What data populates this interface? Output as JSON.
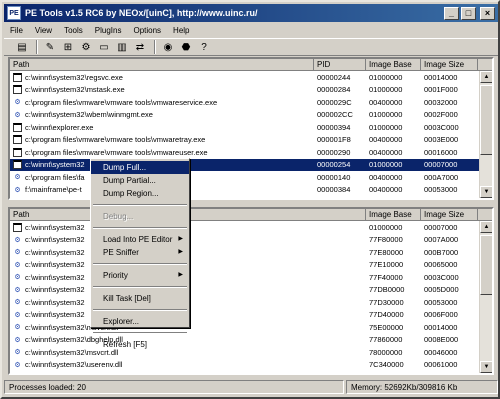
{
  "window": {
    "title": "PE Tools v1.5 RC6 by NEOx/[uinC], http://www.uinc.ru/",
    "btn_min": "_",
    "btn_max": "□",
    "btn_close": "×"
  },
  "menu": [
    "File",
    "View",
    "Tools",
    "PlugIns",
    "Options",
    "Help"
  ],
  "toolbar": {
    "icons": [
      "list-icon",
      "edit-icon",
      "tree-icon",
      "sniff-icon",
      "folder-icon",
      "editor-icon",
      "compare-icon",
      "globe-icon",
      "shield-icon",
      "help-icon"
    ],
    "glyphs": [
      "▤",
      "✎",
      "⊞",
      "⚙",
      "▭",
      "▥",
      "⇄",
      "◉",
      "⬣",
      "?"
    ]
  },
  "processes": {
    "headers": [
      "Path",
      "PID",
      "Image Base",
      "Image Size"
    ],
    "rows": [
      {
        "path": "c:\\winnt\\system32\\regsvc.exe",
        "pid": "00000244",
        "base": "01000000",
        "size": "00014000",
        "icon": "exe"
      },
      {
        "path": "c:\\winnt\\system32\\mstask.exe",
        "pid": "00000284",
        "base": "01000000",
        "size": "0001F000",
        "icon": "exe"
      },
      {
        "path": "c:\\program files\\vmware\\vmware tools\\vmwareservice.exe",
        "pid": "0000029C",
        "base": "00400000",
        "size": "00032000",
        "icon": "gear"
      },
      {
        "path": "c:\\winnt\\system32\\wbem\\winmgmt.exe",
        "pid": "000002CC",
        "base": "01000000",
        "size": "0002F000",
        "icon": "gear"
      },
      {
        "path": "c:\\winnt\\explorer.exe",
        "pid": "00000394",
        "base": "01000000",
        "size": "0003C000",
        "icon": "exe"
      },
      {
        "path": "c:\\program files\\vmware\\vmware tools\\vmwaretray.exe",
        "pid": "000001F8",
        "base": "00400000",
        "size": "0003E000",
        "icon": "exe"
      },
      {
        "path": "c:\\program files\\vmware\\vmware tools\\vmwareuser.exe",
        "pid": "00000290",
        "base": "00400000",
        "size": "00016000",
        "icon": "exe"
      },
      {
        "path": "c:\\winnt\\system32",
        "pid": "00000254",
        "base": "01000000",
        "size": "00007000",
        "icon": "exe",
        "selected": true
      },
      {
        "path": "c:\\program files\\fa",
        "pid": "00000140",
        "base": "00400000",
        "size": "000A7000",
        "icon": "gear"
      },
      {
        "path": "f:\\mainframe\\pe-t",
        "pid": "00000384",
        "base": "00400000",
        "size": "00053000",
        "icon": "gear"
      }
    ]
  },
  "modules": {
    "headers": [
      "Path",
      "Image Base",
      "Image Size"
    ],
    "rows": [
      {
        "path": "c:\\winnt\\system32",
        "base": "01000000",
        "size": "00007000",
        "icon": "exe"
      },
      {
        "path": "c:\\winnt\\system32",
        "base": "77F80000",
        "size": "0007A000",
        "icon": "gear"
      },
      {
        "path": "c:\\winnt\\system32",
        "base": "77E80000",
        "size": "000B7000",
        "icon": "gear"
      },
      {
        "path": "c:\\winnt\\system32",
        "base": "77E10000",
        "size": "00065000",
        "icon": "gear"
      },
      {
        "path": "c:\\winnt\\system32",
        "base": "77F40000",
        "size": "0003C000",
        "icon": "gear"
      },
      {
        "path": "c:\\winnt\\system32",
        "base": "77DB0000",
        "size": "0005D000",
        "icon": "gear"
      },
      {
        "path": "c:\\winnt\\system32",
        "base": "77D30000",
        "size": "00053000",
        "icon": "gear"
      },
      {
        "path": "c:\\winnt\\system32",
        "base": "77D40000",
        "size": "0006F000",
        "icon": "gear"
      },
      {
        "path": "c:\\winnt\\system32\\msvcrt.dll",
        "base": "75E00000",
        "size": "00014000",
        "icon": "gear"
      },
      {
        "path": "c:\\winnt\\system32\\dbghelp.dll",
        "base": "77860000",
        "size": "0008E000",
        "icon": "gear"
      },
      {
        "path": "c:\\winnt\\system32\\msvcrt.dll",
        "base": "78000000",
        "size": "00046000",
        "icon": "gear"
      },
      {
        "path": "c:\\winnt\\system32\\userenv.dll",
        "base": "7C340000",
        "size": "00061000",
        "icon": "gear"
      }
    ]
  },
  "context_menu": {
    "items": [
      {
        "label": "Dump Full...",
        "state": "highlight"
      },
      {
        "label": "Dump Partial..."
      },
      {
        "label": "Dump Region..."
      },
      {
        "sep": true
      },
      {
        "label": "Debug...",
        "state": "disabled"
      },
      {
        "sep": true
      },
      {
        "label": "Load Into PE Editor",
        "submenu": true
      },
      {
        "label": "PE Sniffer",
        "submenu": true
      },
      {
        "sep": true
      },
      {
        "label": "Priority",
        "submenu": true
      },
      {
        "sep": true
      },
      {
        "label": "Kill Task [Del]"
      },
      {
        "sep": true
      },
      {
        "label": "Explorer..."
      },
      {
        "sep": true
      },
      {
        "label": "Refresh [F5]"
      }
    ]
  },
  "status": {
    "left": "Processes loaded: 20",
    "right": "Memory: 52692Kb/309816 Kb"
  }
}
